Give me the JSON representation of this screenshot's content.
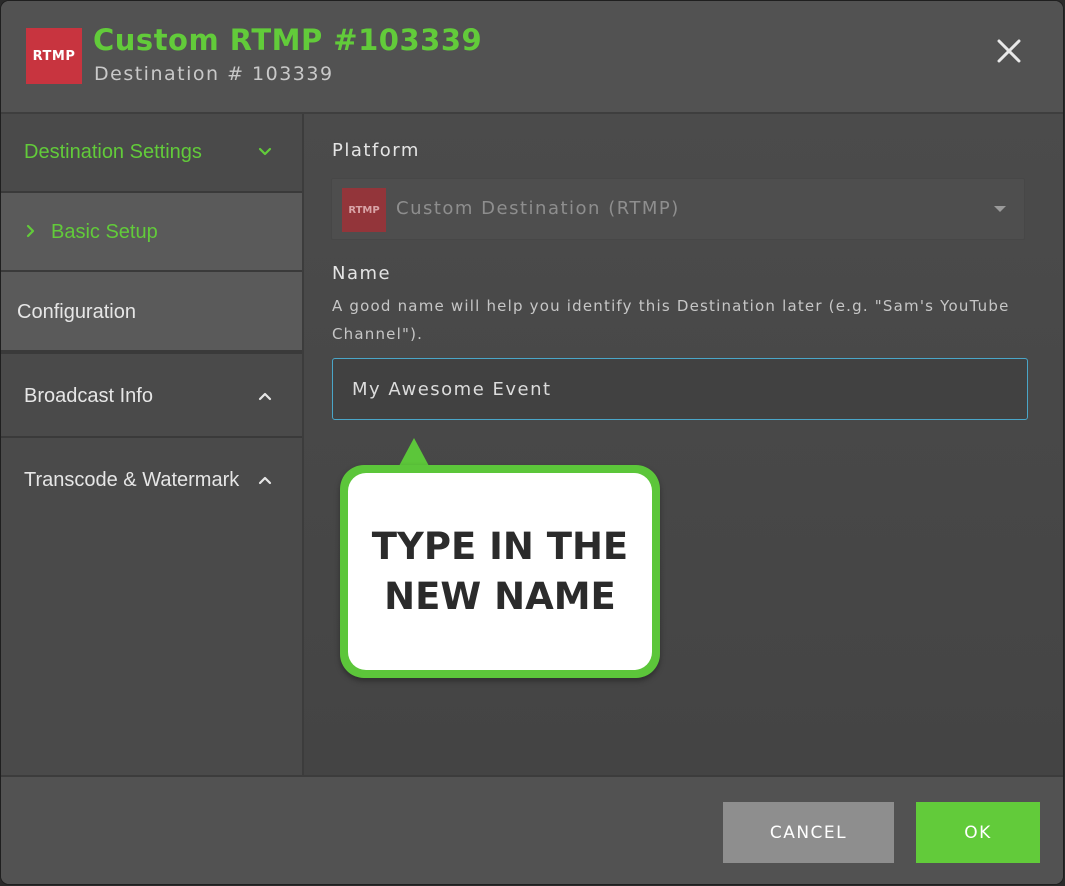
{
  "header": {
    "logo_text": "RTMP",
    "title": "Custom RTMP #103339",
    "subtitle": "Destination # 103339",
    "close_icon": "close-icon"
  },
  "sidebar": {
    "items": [
      {
        "label": "Destination Settings",
        "icon": "chevron-down-icon",
        "active": true
      },
      {
        "label": "Basic Setup",
        "icon": "chevron-right-icon",
        "active": true
      },
      {
        "label": "Configuration"
      },
      {
        "label": "Broadcast Info",
        "icon": "chevron-up-icon"
      },
      {
        "label": "Transcode & Watermark",
        "icon": "chevron-up-icon"
      }
    ]
  },
  "main": {
    "platform": {
      "label": "Platform",
      "logo_text": "RTMP",
      "value": "Custom Destination (RTMP)"
    },
    "name": {
      "label": "Name",
      "help": "A good name will help you identify this Destination later (e.g. \"Sam's YouTube Channel\").",
      "value": "My Awesome Event"
    }
  },
  "callout": {
    "text": "TYPE IN THE NEW NAME"
  },
  "footer": {
    "cancel_label": "CANCEL",
    "ok_label": "OK"
  },
  "colors": {
    "accent": "#62cb3a",
    "logo_red": "#c8343f",
    "focus_border": "#4aa6c8"
  }
}
